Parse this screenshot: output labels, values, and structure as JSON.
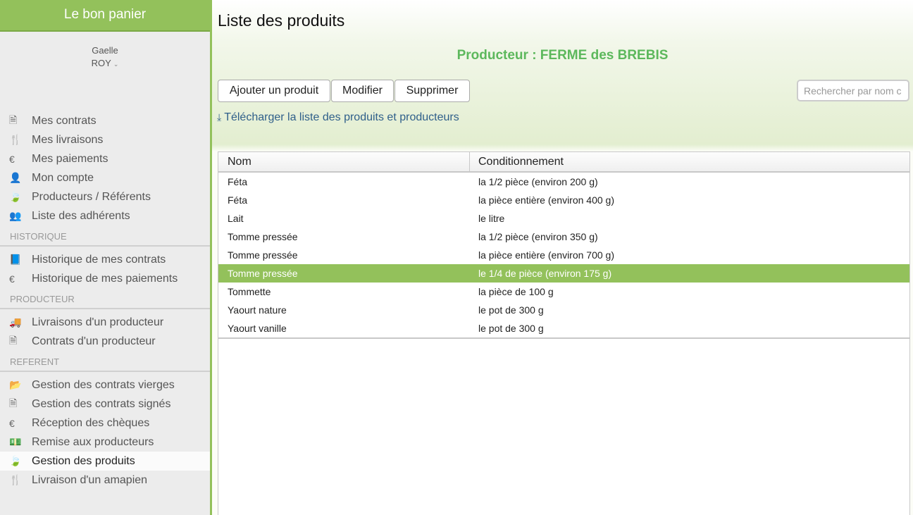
{
  "app": {
    "title": "Le bon panier"
  },
  "user": {
    "first_name": "Gaelle",
    "last_name": "ROY",
    "caret": "⌄"
  },
  "nav_main": [
    {
      "label": "Mes contrats",
      "icon": "document-icon",
      "glyph": "🗎"
    },
    {
      "label": "Mes livraisons",
      "icon": "cutlery-icon",
      "glyph": "🍴"
    },
    {
      "label": "Mes paiements",
      "icon": "euro-icon",
      "glyph": "€"
    },
    {
      "label": "Mon compte",
      "icon": "user-icon",
      "glyph": "👤"
    },
    {
      "label": "Producteurs / Référents",
      "icon": "leaf-icon",
      "glyph": "🍃"
    },
    {
      "label": "Liste des adhérents",
      "icon": "users-icon",
      "glyph": "👥"
    }
  ],
  "section_historique": {
    "title": "HISTORIQUE",
    "items": [
      {
        "label": "Historique de mes contrats",
        "icon": "book-icon",
        "glyph": "📘"
      },
      {
        "label": "Historique de mes paiements",
        "icon": "euro-icon",
        "glyph": "€"
      }
    ]
  },
  "section_producteur": {
    "title": "PRODUCTEUR",
    "items": [
      {
        "label": "Livraisons d'un producteur",
        "icon": "truck-icon",
        "glyph": "🚚"
      },
      {
        "label": "Contrats d'un producteur",
        "icon": "document-icon",
        "glyph": "🗎"
      }
    ]
  },
  "section_referent": {
    "title": "REFERENT",
    "items": [
      {
        "label": "Gestion des contrats vierges",
        "icon": "folder-open-icon",
        "glyph": "📂"
      },
      {
        "label": "Gestion des contrats signés",
        "icon": "document-icon",
        "glyph": "🗎"
      },
      {
        "label": "Réception des chèques",
        "icon": "euro-icon",
        "glyph": "€"
      },
      {
        "label": "Remise aux producteurs",
        "icon": "money-icon",
        "glyph": "💵"
      },
      {
        "label": "Gestion des produits",
        "icon": "leaf-icon",
        "glyph": "🍃",
        "active": true
      },
      {
        "label": "Livraison d'un amapien",
        "icon": "cutlery-icon",
        "glyph": "🍴"
      }
    ]
  },
  "main": {
    "title": "Liste des produits",
    "producer": "Producteur : FERME des BREBIS",
    "buttons": {
      "add": "Ajouter un produit",
      "edit": "Modifier",
      "delete": "Supprimer"
    },
    "search_placeholder": "Rechercher par nom c",
    "download_label": "Télécharger la liste des produits et producteurs",
    "download_glyph": "⤓",
    "table": {
      "headers": [
        "Nom",
        "Conditionnement"
      ],
      "rows": [
        [
          "Féta",
          "la 1/2 pièce (environ 200 g)"
        ],
        [
          "Féta",
          "la pièce entière (environ 400 g)"
        ],
        [
          "Lait",
          "le litre"
        ],
        [
          "Tomme pressée",
          "la 1/2 pièce (environ 350 g)"
        ],
        [
          "Tomme pressée",
          "la pièce entière (environ 700 g)"
        ],
        [
          "Tomme pressée",
          "le 1/4 de pièce (environ 175 g)"
        ],
        [
          "Tommette",
          "la pièce de 100 g"
        ],
        [
          "Yaourt nature",
          "le pot de 300 g"
        ],
        [
          "Yaourt vanille",
          "le pot de 300 g"
        ]
      ],
      "selected_row": 5
    }
  },
  "colors": {
    "accent": "#93c15b",
    "producer": "#5cb85c",
    "link": "#2f5f8a"
  }
}
